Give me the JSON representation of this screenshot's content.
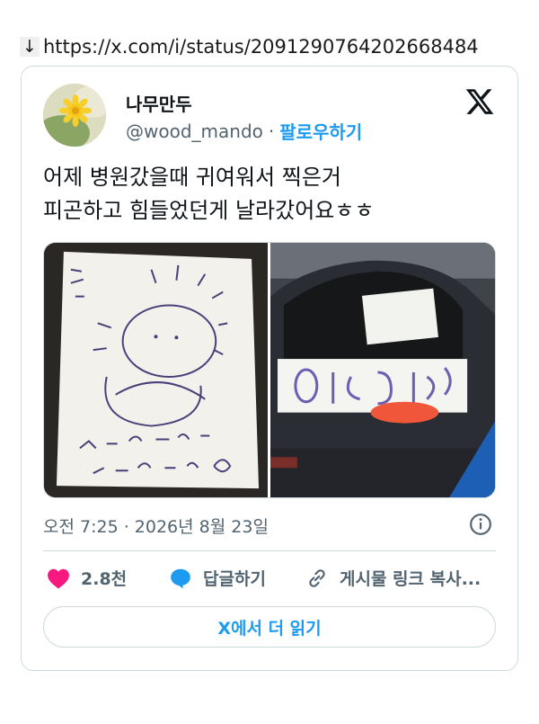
{
  "url_bar": {
    "arrow": "↓",
    "url": "https://x.com/i/status/2091290764202668484"
  },
  "tweet": {
    "author_name": "나무만두",
    "handle": "@wood_mando",
    "separator": "·",
    "follow_label": "팔로우하기",
    "text_line1": "어제 병원갔을때 귀여워서 찍은거",
    "text_line2": "피곤하고 힘들었던게 날라갔어요ㅎㅎ",
    "timestamp": "오전 7:25 · 2026년 8월 23일",
    "photos": [
      {
        "description_icon": "photo-icon"
      },
      {
        "description_icon": "photo-icon"
      }
    ]
  },
  "actions": {
    "like_count": "2.8천",
    "reply_label": "답글하기",
    "copy_link_label": "게시물 링크 복사..."
  },
  "read_more_label": "X에서 더 읽기",
  "colors": {
    "accent": "#1d9bf0",
    "like": "#f91880",
    "text": "#0f1419",
    "secondary": "#536471",
    "border": "#cfd9de"
  }
}
